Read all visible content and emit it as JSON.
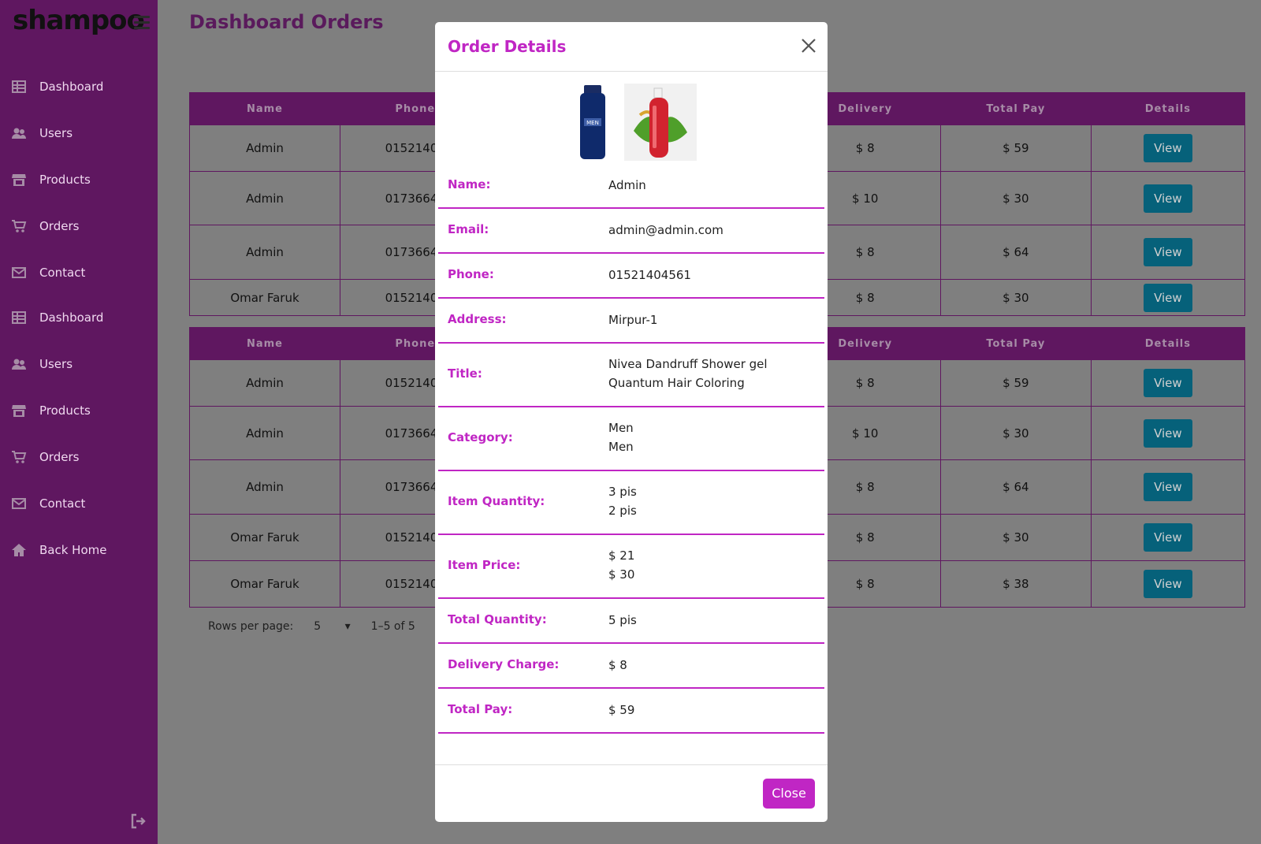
{
  "brand": "shampoo",
  "sidebar": {
    "items": [
      {
        "label": "Dashboard",
        "icon": "grid-icon"
      },
      {
        "label": "Users",
        "icon": "users-icon"
      },
      {
        "label": "Products",
        "icon": "store-icon"
      },
      {
        "label": "Orders",
        "icon": "cart-icon"
      },
      {
        "label": "Contact",
        "icon": "mail-icon"
      },
      {
        "label": "Dashboard",
        "icon": "grid-icon"
      },
      {
        "label": "Users",
        "icon": "users-icon"
      },
      {
        "label": "Products",
        "icon": "store-icon"
      },
      {
        "label": "Orders",
        "icon": "cart-icon"
      },
      {
        "label": "Contact",
        "icon": "mail-icon"
      },
      {
        "label": "Back Home",
        "icon": "home-icon"
      }
    ]
  },
  "main": {
    "title": "Dashboard Orders"
  },
  "tables": {
    "headers": [
      "Name",
      "Phone",
      "Delivery",
      "Total Pay",
      "Details"
    ],
    "view_label": "View",
    "top_rows": [
      {
        "name": "Admin",
        "phone": "01521404",
        "delivery": "$ 8",
        "total": "$ 59"
      },
      {
        "name": "Admin",
        "phone": "01736648",
        "delivery": "$ 10",
        "total": "$ 30"
      },
      {
        "name": "Admin",
        "phone": "01736648",
        "delivery": "$ 8",
        "total": "$ 64"
      },
      {
        "name": "Omar Faruk",
        "phone": "01521404",
        "delivery": "$ 8",
        "total": "$ 30"
      }
    ],
    "bottom_rows": [
      {
        "name": "Admin",
        "phone": "01521404",
        "delivery": "$ 8",
        "total": "$ 59"
      },
      {
        "name": "Admin",
        "phone": "01736648",
        "delivery": "$ 10",
        "total": "$ 30"
      },
      {
        "name": "Admin",
        "phone": "01736648",
        "delivery": "$ 8",
        "total": "$ 64"
      },
      {
        "name": "Omar Faruk",
        "phone": "01521404",
        "delivery": "$ 8",
        "total": "$ 30"
      },
      {
        "name": "Omar Faruk",
        "phone": "01521404",
        "delivery": "$ 8",
        "total": "$ 38"
      }
    ]
  },
  "pagination": {
    "rows_label": "Rows per page:",
    "rows_value": "5",
    "range": "1–5 of 5"
  },
  "modal": {
    "title": "Order Details",
    "close_label": "Close",
    "details": [
      {
        "label": "Name:",
        "value": [
          "Admin"
        ]
      },
      {
        "label": "Email:",
        "value": [
          "admin@admin.com"
        ]
      },
      {
        "label": "Phone:",
        "value": [
          "01521404561"
        ]
      },
      {
        "label": "Address:",
        "value": [
          "Mirpur-1"
        ]
      },
      {
        "label": "Title:",
        "value": [
          "Nivea Dandruff Shower gel",
          "Quantum Hair Coloring"
        ]
      },
      {
        "label": "Category:",
        "value": [
          "Men",
          "Men"
        ]
      },
      {
        "label": "Item Quantity:",
        "value": [
          "3 pis",
          "2 pis"
        ]
      },
      {
        "label": "Item Price:",
        "value": [
          "$ 21",
          "$ 30"
        ]
      },
      {
        "label": "Total Quantity:",
        "value": [
          "5 pis"
        ]
      },
      {
        "label": "Delivery Charge:",
        "value": [
          "$ 8"
        ]
      },
      {
        "label": "Total Pay:",
        "value": [
          "$ 59"
        ]
      }
    ]
  },
  "colors": {
    "sidebar": "#5f1760",
    "accent": "#c026c4",
    "view_button": "#06617a",
    "overlay": "#7f7f7f"
  }
}
